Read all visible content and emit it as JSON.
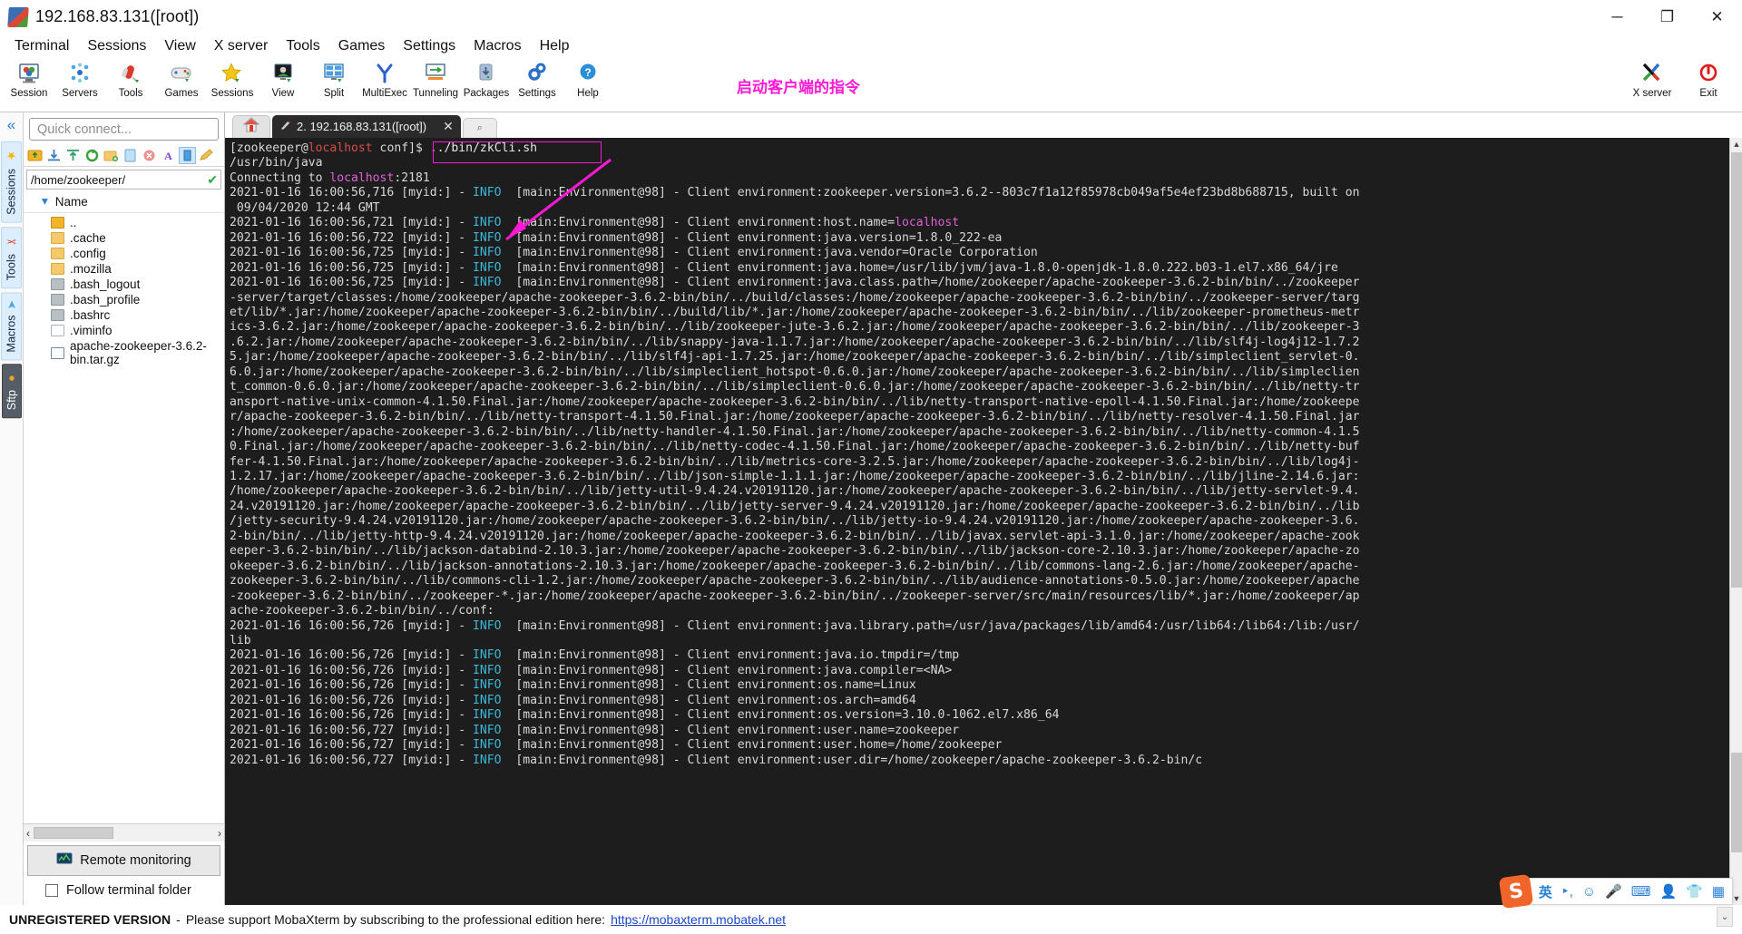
{
  "window": {
    "title": "192.168.83.131([root])",
    "minimize": "─",
    "maximize": "❐",
    "close": "✕"
  },
  "menubar": [
    "Terminal",
    "Sessions",
    "View",
    "X server",
    "Tools",
    "Games",
    "Settings",
    "Macros",
    "Help"
  ],
  "toolbar": {
    "buttons": [
      {
        "label": "Session",
        "icon": "session-icon"
      },
      {
        "label": "Servers",
        "icon": "servers-icon"
      },
      {
        "label": "Tools",
        "icon": "tools-icon"
      },
      {
        "label": "Games",
        "icon": "games-icon"
      },
      {
        "label": "Sessions",
        "icon": "sessions-star-icon"
      },
      {
        "label": "View",
        "icon": "view-icon"
      },
      {
        "label": "Split",
        "icon": "split-icon"
      },
      {
        "label": "MultiExec",
        "icon": "multiexec-icon"
      },
      {
        "label": "Tunneling",
        "icon": "tunneling-icon"
      },
      {
        "label": "Packages",
        "icon": "packages-icon"
      },
      {
        "label": "Settings",
        "icon": "settings-gear-icon"
      },
      {
        "label": "Help",
        "icon": "help-question-icon"
      }
    ],
    "right_buttons": [
      {
        "label": "X server",
        "icon": "x-server-icon"
      },
      {
        "label": "Exit",
        "icon": "power-exit-icon"
      }
    ]
  },
  "annotation": {
    "text": "启动客户端的指令",
    "color": "#ff19d4"
  },
  "rail": {
    "collapse": "«",
    "tabs": [
      "Sessions",
      "Tools",
      "Macros",
      "Sftp"
    ]
  },
  "sidebar": {
    "quick_connect_placeholder": "Quick connect...",
    "path": "/home/zookeeper/",
    "column_header": "Name",
    "sort_caret": "▾",
    "status_ok": "✔",
    "sftp_tools": [
      "up-dir-icon",
      "download-icon",
      "upload-icon",
      "refresh-icon",
      "new-folder-icon",
      "new-file-icon",
      "delete-icon",
      "text-mode-icon",
      "binary-mode-icon",
      "edit-icon"
    ],
    "files": [
      {
        "name": "..",
        "type": "up"
      },
      {
        "name": ".cache",
        "type": "folder"
      },
      {
        "name": ".config",
        "type": "folder"
      },
      {
        "name": ".mozilla",
        "type": "folder"
      },
      {
        "name": ".bash_logout",
        "type": "sh"
      },
      {
        "name": ".bash_profile",
        "type": "sh"
      },
      {
        "name": ".bashrc",
        "type": "sh"
      },
      {
        "name": ".viminfo",
        "type": "doc"
      },
      {
        "name": "apache-zookeeper-3.6.2-bin.tar.gz",
        "type": "arch"
      }
    ],
    "scroll_left": "‹",
    "scroll_right": "›",
    "remote_monitoring": "Remote monitoring",
    "follow_terminal_folder": "Follow terminal folder"
  },
  "tabs": {
    "home_icon": "home-icon",
    "active": "2. 192.168.83.131([root])",
    "close_glyph": "✕",
    "new_tab_glyph": "⌕"
  },
  "terminal": {
    "prompt_user": "zookeeper",
    "prompt_host": "localhost",
    "prompt_dir": "conf",
    "command": "../bin/zkCli.sh",
    "lines": [
      {
        "k": "prompt"
      },
      {
        "k": "p",
        "t": "/usr/bin/java"
      },
      {
        "k": "conn",
        "pre": "Connecting to ",
        "host": "localhost",
        "post": ":2181"
      },
      {
        "k": "log",
        "msg": "Client environment:zookeeper.version=3.6.2--803c7f1a12f85978cb049af5e4ef23bd8b688715, built on"
      },
      {
        "k": "p",
        "t": " 09/04/2020 12:44 GMT"
      },
      {
        "k": "log",
        "ts": "2021-01-16 16:00:56,721",
        "msg": "Client environment:host.name=",
        "hl": "localhost"
      },
      {
        "k": "log",
        "ts": "2021-01-16 16:00:56,722",
        "msg": "Client environment:java.version=1.8.0_222-ea"
      },
      {
        "k": "log",
        "ts": "2021-01-16 16:00:56,725",
        "msg": "Client environment:java.vendor=Oracle Corporation"
      },
      {
        "k": "log",
        "ts": "2021-01-16 16:00:56,725",
        "msg": "Client environment:java.home=/usr/lib/jvm/java-1.8.0-openjdk-1.8.0.222.b03-1.el7.x86_64/jre"
      },
      {
        "k": "log",
        "ts": "2021-01-16 16:00:56,725",
        "msg": "Client environment:java.class.path=/home/zookeeper/apache-zookeeper-3.6.2-bin/bin/../zookeeper"
      },
      {
        "k": "p",
        "t": "-server/target/classes:/home/zookeeper/apache-zookeeper-3.6.2-bin/bin/../build/classes:/home/zookeeper/apache-zookeeper-3.6.2-bin/bin/../zookeeper-server/targ"
      },
      {
        "k": "p",
        "t": "et/lib/*.jar:/home/zookeeper/apache-zookeeper-3.6.2-bin/bin/../build/lib/*.jar:/home/zookeeper/apache-zookeeper-3.6.2-bin/bin/../lib/zookeeper-prometheus-metr"
      },
      {
        "k": "p",
        "t": "ics-3.6.2.jar:/home/zookeeper/apache-zookeeper-3.6.2-bin/bin/../lib/zookeeper-jute-3.6.2.jar:/home/zookeeper/apache-zookeeper-3.6.2-bin/bin/../lib/zookeeper-3"
      },
      {
        "k": "p",
        "t": ".6.2.jar:/home/zookeeper/apache-zookeeper-3.6.2-bin/bin/../lib/snappy-java-1.1.7.jar:/home/zookeeper/apache-zookeeper-3.6.2-bin/bin/../lib/slf4j-log4j12-1.7.2"
      },
      {
        "k": "p",
        "t": "5.jar:/home/zookeeper/apache-zookeeper-3.6.2-bin/bin/../lib/slf4j-api-1.7.25.jar:/home/zookeeper/apache-zookeeper-3.6.2-bin/bin/../lib/simpleclient_servlet-0."
      },
      {
        "k": "p",
        "t": "6.0.jar:/home/zookeeper/apache-zookeeper-3.6.2-bin/bin/../lib/simpleclient_hotspot-0.6.0.jar:/home/zookeeper/apache-zookeeper-3.6.2-bin/bin/../lib/simpleclien"
      },
      {
        "k": "p",
        "t": "t_common-0.6.0.jar:/home/zookeeper/apache-zookeeper-3.6.2-bin/bin/../lib/simpleclient-0.6.0.jar:/home/zookeeper/apache-zookeeper-3.6.2-bin/bin/../lib/netty-tr"
      },
      {
        "k": "p",
        "t": "ansport-native-unix-common-4.1.50.Final.jar:/home/zookeeper/apache-zookeeper-3.6.2-bin/bin/../lib/netty-transport-native-epoll-4.1.50.Final.jar:/home/zookeepe"
      },
      {
        "k": "p",
        "t": "r/apache-zookeeper-3.6.2-bin/bin/../lib/netty-transport-4.1.50.Final.jar:/home/zookeeper/apache-zookeeper-3.6.2-bin/bin/../lib/netty-resolver-4.1.50.Final.jar"
      },
      {
        "k": "p",
        "t": ":/home/zookeeper/apache-zookeeper-3.6.2-bin/bin/../lib/netty-handler-4.1.50.Final.jar:/home/zookeeper/apache-zookeeper-3.6.2-bin/bin/../lib/netty-common-4.1.5"
      },
      {
        "k": "p",
        "t": "0.Final.jar:/home/zookeeper/apache-zookeeper-3.6.2-bin/bin/../lib/netty-codec-4.1.50.Final.jar:/home/zookeeper/apache-zookeeper-3.6.2-bin/bin/../lib/netty-buf"
      },
      {
        "k": "p",
        "t": "fer-4.1.50.Final.jar:/home/zookeeper/apache-zookeeper-3.6.2-bin/bin/../lib/metrics-core-3.2.5.jar:/home/zookeeper/apache-zookeeper-3.6.2-bin/bin/../lib/log4j-"
      },
      {
        "k": "p",
        "t": "1.2.17.jar:/home/zookeeper/apache-zookeeper-3.6.2-bin/bin/../lib/json-simple-1.1.1.jar:/home/zookeeper/apache-zookeeper-3.6.2-bin/bin/../lib/jline-2.14.6.jar:"
      },
      {
        "k": "p",
        "t": "/home/zookeeper/apache-zookeeper-3.6.2-bin/bin/../lib/jetty-util-9.4.24.v20191120.jar:/home/zookeeper/apache-zookeeper-3.6.2-bin/bin/../lib/jetty-servlet-9.4."
      },
      {
        "k": "p",
        "t": "24.v20191120.jar:/home/zookeeper/apache-zookeeper-3.6.2-bin/bin/../lib/jetty-server-9.4.24.v20191120.jar:/home/zookeeper/apache-zookeeper-3.6.2-bin/bin/../lib"
      },
      {
        "k": "p",
        "t": "/jetty-security-9.4.24.v20191120.jar:/home/zookeeper/apache-zookeeper-3.6.2-bin/bin/../lib/jetty-io-9.4.24.v20191120.jar:/home/zookeeper/apache-zookeeper-3.6."
      },
      {
        "k": "p",
        "t": "2-bin/bin/../lib/jetty-http-9.4.24.v20191120.jar:/home/zookeeper/apache-zookeeper-3.6.2-bin/bin/../lib/javax.servlet-api-3.1.0.jar:/home/zookeeper/apache-zook"
      },
      {
        "k": "p",
        "t": "eeper-3.6.2-bin/bin/../lib/jackson-databind-2.10.3.jar:/home/zookeeper/apache-zookeeper-3.6.2-bin/bin/../lib/jackson-core-2.10.3.jar:/home/zookeeper/apache-zo"
      },
      {
        "k": "p",
        "t": "okeeper-3.6.2-bin/bin/../lib/jackson-annotations-2.10.3.jar:/home/zookeeper/apache-zookeeper-3.6.2-bin/bin/../lib/commons-lang-2.6.jar:/home/zookeeper/apache-"
      },
      {
        "k": "p",
        "t": "zookeeper-3.6.2-bin/bin/../lib/commons-cli-1.2.jar:/home/zookeeper/apache-zookeeper-3.6.2-bin/bin/../lib/audience-annotations-0.5.0.jar:/home/zookeeper/apache"
      },
      {
        "k": "p",
        "t": "-zookeeper-3.6.2-bin/bin/../zookeeper-*.jar:/home/zookeeper/apache-zookeeper-3.6.2-bin/bin/../zookeeper-server/src/main/resources/lib/*.jar:/home/zookeeper/ap"
      },
      {
        "k": "p",
        "t": "ache-zookeeper-3.6.2-bin/bin/../conf:"
      },
      {
        "k": "log",
        "ts": "2021-01-16 16:00:56,726",
        "msg": "Client environment:java.library.path=/usr/java/packages/lib/amd64:/usr/lib64:/lib64:/lib:/usr/"
      },
      {
        "k": "p",
        "t": "lib"
      },
      {
        "k": "log",
        "ts": "2021-01-16 16:00:56,726",
        "msg": "Client environment:java.io.tmpdir=/tmp"
      },
      {
        "k": "log",
        "ts": "2021-01-16 16:00:56,726",
        "msg": "Client environment:java.compiler=<NA>"
      },
      {
        "k": "log",
        "ts": "2021-01-16 16:00:56,726",
        "msg": "Client environment:os.name=Linux"
      },
      {
        "k": "log",
        "ts": "2021-01-16 16:00:56,726",
        "msg": "Client environment:os.arch=amd64"
      },
      {
        "k": "log",
        "ts": "2021-01-16 16:00:56,726",
        "msg": "Client environment:os.version=3.10.0-1062.el7.x86_64"
      },
      {
        "k": "log",
        "ts": "2021-01-16 16:00:56,727",
        "msg": "Client environment:user.name=zookeeper"
      },
      {
        "k": "log",
        "ts": "2021-01-16 16:00:56,727",
        "msg": "Client environment:user.home=/home/zookeeper"
      },
      {
        "k": "log",
        "ts": "2021-01-16 16:00:56,727",
        "msg": "Client environment:user.dir=/home/zookeeper/apache-zookeeper-3.6.2-bin/c"
      }
    ],
    "default_ts": "2021-01-16 16:00:56,716",
    "level": "INFO",
    "logger": "[main:Environment@98]"
  },
  "statusbar": {
    "unregistered": "UNREGISTERED VERSION",
    "dash": "-",
    "message": "Please support MobaXterm by subscribing to the professional edition here:",
    "link": "https://mobaxterm.mobatek.net"
  },
  "ime": {
    "logo": "S",
    "mode": "英",
    "items": [
      "punctuation-icon",
      "emoji-icon",
      "microphone-icon",
      "keyboard-icon",
      "user-icon",
      "skin-icon",
      "apps-icon"
    ],
    "caret": "⌄"
  }
}
